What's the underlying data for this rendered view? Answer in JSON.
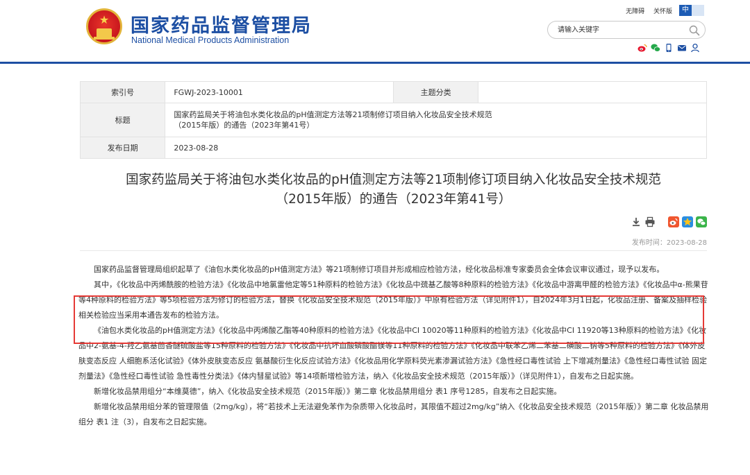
{
  "header": {
    "title": "国家药品监督管理局",
    "subtitle": "National Medical Products Administration",
    "accessibility_link": "无障碍",
    "old_version_link": "关怀版",
    "lang_zh": "中",
    "lang_en": "EN",
    "search": {
      "placeholder": "请输入关键字"
    },
    "social_icons": [
      "weibo-icon",
      "wechat-icon",
      "mobile-icon",
      "mail-icon",
      "user-icon"
    ]
  },
  "meta": {
    "index_label": "索引号",
    "index_value": "FGWJ-2023-10001",
    "topic_label": "主题分类",
    "topic_value": "",
    "title_label": "标题",
    "title_value_line1": "国家药监局关于将油包水类化妆品的pH值测定方法等21项制修订项目纳入化妆品安全技术规范",
    "title_value_line2": "（2015年版）的通告（2023年第41号）",
    "date_label": "发布日期",
    "date_value": "2023-08-28"
  },
  "article": {
    "title_line1": "国家药监局关于将油包水类化妆品的pH值测定方法等21项制修订项目纳入化妆品安全技术规范",
    "title_line2": "（2015年版）的通告（2023年第41号）",
    "publish_time": "发布时间：2023-08-28",
    "tools": [
      "download-icon",
      "print-icon",
      "weibo-share-icon",
      "qzone-share-icon",
      "wechat-share-icon"
    ],
    "paragraphs": [
      "国家药品监督管理局组织起草了《油包水类化妆品的pH值测定方法》等21项制修订项目并形成相应检验方法，经化妆品标准专家委员会全体会议审议通过，现予以发布。",
      "其中，《化妆品中丙烯酰胺的检验方法》《化妆品中地氯雷他定等51种原料的检验方法》《化妆品中巯基乙酸等8种原料的检验方法》《化妆品中游离甲醛的检验方法》《化妆品中α-熊果苷等4种原料的检验方法》等5项检验方法为修订的检验方法，替换《化妆品安全技术规范（2015年版）》中原有检验方法（详见附件1），自2024年3月1日起，化妆品注册、备案及抽样检验相关检验应当采用本通告发布的检验方法。",
      "《油包水类化妆品的pH值测定方法》《化妆品中丙烯酸乙酯等40种原料的检验方法》《化妆品中CI 10020等11种原料的检验方法》《化妆品中CI 11920等13种原料的检验方法》《化妆品中2-氨基-4-羟乙氨基茴香醚硫酸盐等15种原料的检验方法》《化妆品中抗坏血酸磷酸酯镁等11种原料的检验方法》《化妆品中联苯乙烯二苯基二磺酸二钠等5种原料的检验方法》《体外皮肤变态反应 人细胞系活化试验》《体外皮肤变态反应 氨基酸衍生化反应试验方法》《化妆品用化学原料荧光素渗漏试验方法》《急性经口毒性试验 上下增减剂量法》《急性经口毒性试验 固定剂量法》《急性经口毒性试验 急性毒性分类法》《体内彗星试验》等14项新增检验方法，纳入《化妆品安全技术规范（2015年版）》（详见附件1），自发布之日起实施。",
      "新增化妆品禁用组分“本维莫德”，纳入《化妆品安全技术规范（2015年版）》第二章 化妆品禁用组分 表1 序号1285，自发布之日起实施。",
      "新增化妆品禁用组分苯的管理限值（2mg/kg），将“若技术上无法避免苯作为杂质带入化妆品时，其限值不超过2mg/kg”纳入《化妆品安全技术规范（2015年版）》第二章 化妆品禁用组分 表1 注（3），自发布之日起实施。"
    ]
  }
}
